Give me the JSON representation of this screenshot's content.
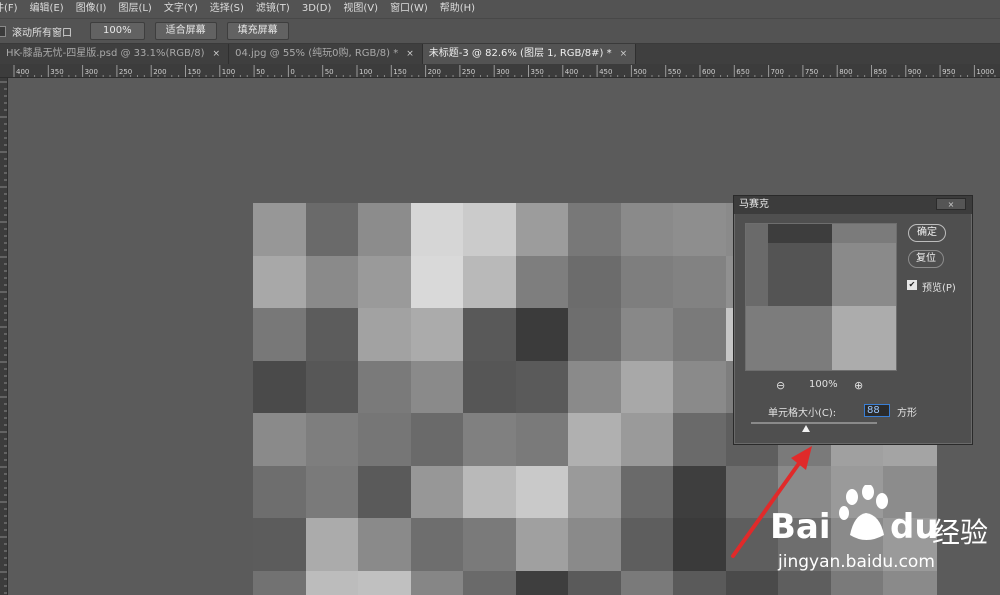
{
  "menu": {
    "items": [
      "文件(F)",
      "编辑(E)",
      "图像(I)",
      "图层(L)",
      "文字(Y)",
      "选择(S)",
      "滤镜(T)",
      "3D(D)",
      "视图(V)",
      "窗口(W)",
      "帮助(H)"
    ]
  },
  "options": {
    "scroll_all": "滚动所有窗口",
    "zoom_value": "100%",
    "fit_screen": "适合屏幕",
    "fill_screen": "填充屏幕"
  },
  "tabs": [
    {
      "label": "HK-膝晶无忧-四星版.psd @ 33.1%(RGB/8)",
      "close": "×"
    },
    {
      "label": "04.jpg @ 55% (纯玩0购, RGB/8) *",
      "close": "×"
    },
    {
      "label": "未标题-3 @ 82.6% (图层 1, RGB/8#) *",
      "close": "×"
    }
  ],
  "ruler": {
    "top_labels": [
      "400",
      "350",
      "300",
      "250",
      "200",
      "150",
      "100",
      "50",
      "0",
      "50",
      "100",
      "150",
      "200",
      "250",
      "300",
      "350",
      "400",
      "450",
      "500",
      "550",
      "600",
      "650",
      "700",
      "750",
      "800",
      "850",
      "900",
      "950",
      "1000"
    ]
  },
  "mosaic": {
    "rows": [
      [
        "#979797",
        "#6a6a6a",
        "#8c8c8c",
        "#d6d6d6",
        "#cbcbcb",
        "#9c9c9c",
        "#787878",
        "#8a8a8a",
        "#8e8e8e",
        "#8a8a8a",
        "#787878",
        "#909090",
        "#aaaaaa"
      ],
      [
        "#a8a8a8",
        "#8a8a8a",
        "#9a9a9a",
        "#d9d9d9",
        "#b9b9b9",
        "#7e7e7e",
        "#6c6c6c",
        "#7e7e7e",
        "#828282",
        "#909090",
        "#7a7a7a",
        "#929292",
        "#a8a8a8"
      ],
      [
        "#787878",
        "#5c5c5c",
        "#a2a2a2",
        "#ababab",
        "#595959",
        "#3b3b3b",
        "#6e6e6e",
        "#888888",
        "#7a7a7a",
        "#c6c6c6",
        "#7e7e7e",
        "#8a8a8a",
        "#a4a4a4"
      ],
      [
        "#4a4a4a",
        "#575757",
        "#7a7a7a",
        "#8a8a8a",
        "#565656",
        "#5a5a5a",
        "#8a8a8a",
        "#a8a8a8",
        "#8a8a8a",
        "#7e7e7e",
        "#7a7a7a",
        "#8a8a8a",
        "#9a9a9a"
      ],
      [
        "#8a8a8a",
        "#7e7e7e",
        "#767676",
        "#6a6a6a",
        "#808080",
        "#7a7a7a",
        "#b0b0b0",
        "#9a9a9a",
        "#6a6a6a",
        "#5e5e5e",
        "#7a7a7a",
        "#a0a0a0",
        "#a4a4a4"
      ],
      [
        "#6e6e6e",
        "#7a7a7a",
        "#5a5a5a",
        "#979797",
        "#b9b9b9",
        "#c9c9c9",
        "#9a9a9a",
        "#6a6a6a",
        "#3e3e3e",
        "#6e6e6e",
        "#8a8a8a",
        "#9a9a9a",
        "#8c8c8c"
      ],
      [
        "#5c5c5c",
        "#ababab",
        "#8a8a8a",
        "#6e6e6e",
        "#7a7a7a",
        "#a0a0a0",
        "#8a8a8a",
        "#5e5e5e",
        "#3a3a3a",
        "#5e5e5e",
        "#6e6e6e",
        "#8a8a8a",
        "#9a9a9a"
      ],
      [
        "#727272",
        "#bcbcbc",
        "#c0c0c0",
        "#868686",
        "#6a6a6a",
        "#3e3e3e",
        "#5a5a5a",
        "#7a7a7a",
        "#5a5a5a",
        "#4a4a4a",
        "#5e5e5e",
        "#7a7a7a",
        "#8a8a8a"
      ]
    ]
  },
  "dialog": {
    "title": "马赛克",
    "close": "×",
    "ok": "确定",
    "reset": "复位",
    "preview_check": "✔",
    "preview_label": "预览(P)",
    "zoom_out": "⊖",
    "zoom_level": "100%",
    "zoom_in": "⊕",
    "cell_size_label": "单元格大小(C):",
    "cell_size_value": "88",
    "cell_unit": "方形",
    "preview_colors": [
      "#6a6a6a",
      "#3d3d3d",
      "#7b7b7b",
      "#545454",
      "#8a8a8a",
      "#7c7c7c",
      "#acacac"
    ]
  },
  "watermark": {
    "brand_a": "Bai",
    "brand_b": "du",
    "brand_cn": "经验",
    "url": "jingyan.baidu.com"
  },
  "colors": {
    "arrow": "#e02a2a",
    "accent": "#3a7fd5"
  }
}
